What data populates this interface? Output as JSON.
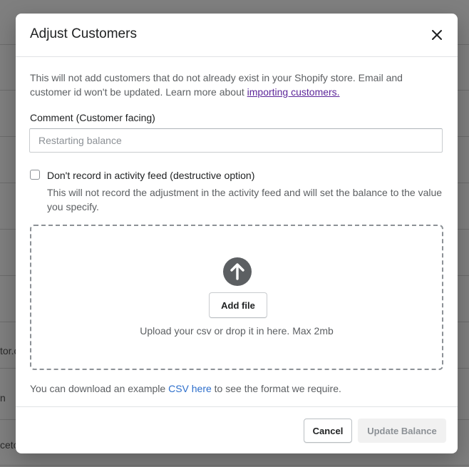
{
  "background": {
    "rows": [
      "tor.c",
      "n",
      "ceto"
    ]
  },
  "modal": {
    "title": "Adjust Customers",
    "close_icon": "close-icon",
    "intro_text": "This will not add customers that do not already exist in your Shopify store. Email and customer id won't be updated. Learn more about ",
    "intro_link": "importing customers.",
    "comment_label": "Comment (Customer facing)",
    "comment_placeholder": "Restarting balance",
    "comment_value": "",
    "checkbox_label": "Don't record in activity feed (destructive option)",
    "checkbox_checked": false,
    "checkbox_help": "This will not record the adjustment in the activity feed and will set the balance to the value you specify.",
    "dropzone": {
      "icon": "upload-arrow-icon",
      "button_label": "Add file",
      "hint": "Upload your csv or drop it in here. Max 2mb"
    },
    "download_before": "You can download an example ",
    "download_link": "CSV here",
    "download_after": " to see the format we require.",
    "footer": {
      "cancel_label": "Cancel",
      "update_label": "Update Balance"
    }
  },
  "colors": {
    "link_purple": "#5c2699",
    "link_blue": "#2c6ecb",
    "icon_dark": "#5c5f62"
  }
}
